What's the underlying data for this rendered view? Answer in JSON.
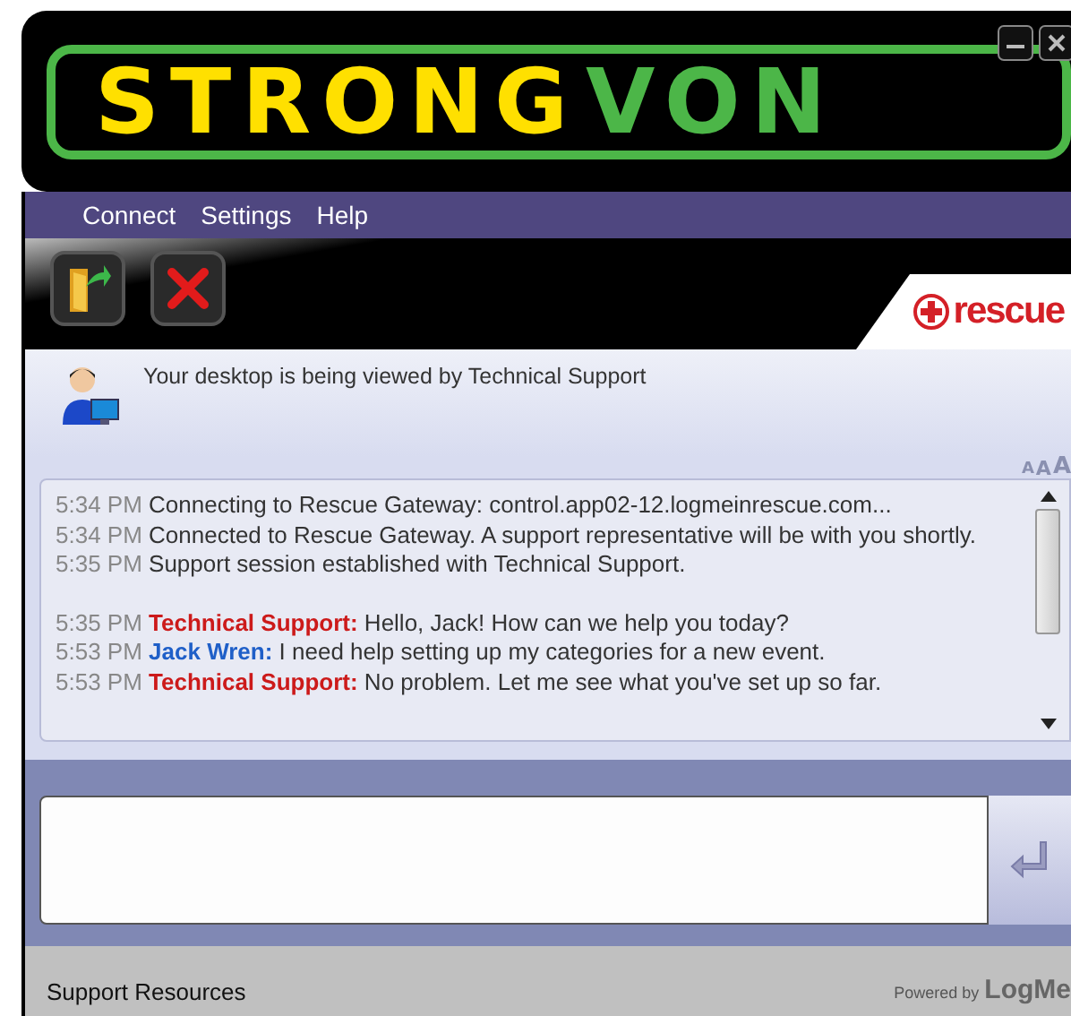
{
  "logo": {
    "part_1": "STRONG",
    "part_2": "VON"
  },
  "menu": [
    "Connect",
    "Settings",
    "Help"
  ],
  "brand": "rescue",
  "status": {
    "text": "Your desktop is being viewed by Technical Support"
  },
  "font_size_buttons": [
    "A",
    "A",
    "A"
  ],
  "messages": [
    {
      "kind": "system",
      "time": "5:34 PM",
      "text": "Connecting to Rescue Gateway: control.app02-12.logmeinrescue.com..."
    },
    {
      "kind": "system",
      "time": "5:34 PM",
      "text": "Connected to Rescue Gateway. A support representative will be with you shortly."
    },
    {
      "kind": "system",
      "time": "5:35 PM",
      "text": "Support session established with Technical Support."
    },
    {
      "kind": "gap"
    },
    {
      "kind": "chat",
      "time": "5:35 PM",
      "sender": "Technical Support:",
      "color": "#cc1a1a",
      "text": "Hello, Jack! How can we help you today?"
    },
    {
      "kind": "chat",
      "time": "5:53 PM",
      "sender": "Jack Wren:",
      "color": "#1f5fc8",
      "text": "I need help setting up my categories for a new event."
    },
    {
      "kind": "chat",
      "time": "5:53 PM",
      "sender": "Technical Support:",
      "color": "#cc1a1a",
      "text": "No problem. Let me see what you've set up so far."
    }
  ],
  "footer": {
    "link": "Support Resources",
    "powered": "Powered by",
    "vendor": "LogMe"
  }
}
